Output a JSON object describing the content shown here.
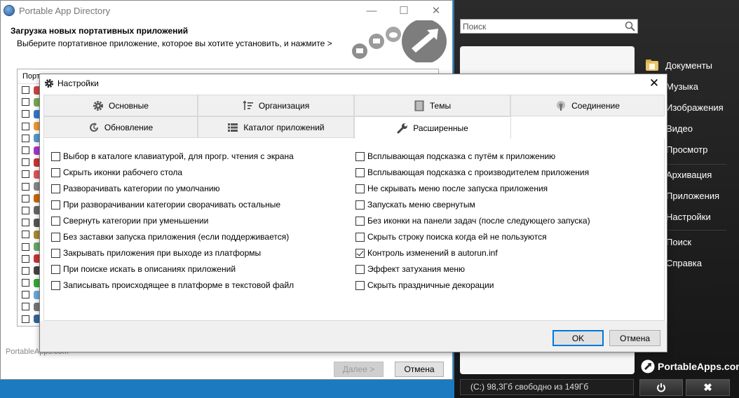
{
  "directory_window": {
    "title": "Portable App Directory",
    "header_title": "Загрузка новых портативных приложений",
    "header_subtitle": "Выберите портативное приложение, которое вы хотите установить, и нажмите >",
    "list_header": "Порт",
    "rows_count_visible": 22,
    "footer_text": "PortableApps.com",
    "next_button": "Далее >",
    "cancel_button": "Отмена"
  },
  "portableapps_menu": {
    "search_placeholder": "Поиск",
    "items": [
      {
        "label": "Документы",
        "icon": "folder-icon"
      },
      {
        "label": "Музыка"
      },
      {
        "label": "Изображения"
      },
      {
        "label": "Видео"
      },
      {
        "label": "Просмотр"
      },
      {
        "label": "Архивация"
      },
      {
        "label": "Приложения"
      },
      {
        "label": "Настройки"
      },
      {
        "label": "Поиск"
      },
      {
        "label": "Справка"
      }
    ],
    "brand": "PortableApps.com",
    "status": "(C:) 98,3Гб свободно из 149Гб",
    "power_icon": "power-icon",
    "close_icon": "close-icon"
  },
  "settings_dialog": {
    "title": "Настройки",
    "tabs_row1": [
      {
        "label": "Основные",
        "icon": "gear-icon"
      },
      {
        "label": "Организация",
        "icon": "sort-icon"
      },
      {
        "label": "Темы",
        "icon": "theme-icon"
      },
      {
        "label": "Соединение",
        "icon": "connection-icon"
      }
    ],
    "tabs_row2": [
      {
        "label": "Обновление",
        "icon": "refresh-icon"
      },
      {
        "label": "Каталог приложений",
        "icon": "catalog-icon"
      },
      {
        "label": "Расширенные",
        "icon": "wrench-icon",
        "active": true
      }
    ],
    "options_left": [
      {
        "label": "Выбор в каталоге клавиатурой, для прогр. чтения с экрана",
        "checked": false
      },
      {
        "label": "Скрыть иконки рабочего стола",
        "checked": false
      },
      {
        "label": "Разворачивать категории по умолчанию",
        "checked": false
      },
      {
        "label": "При разворачивании категории сворачивать остальные",
        "checked": false
      },
      {
        "label": "Свернуть категории при уменьшении",
        "checked": false
      },
      {
        "label": "Без заставки запуска приложения (если поддерживается)",
        "checked": false
      },
      {
        "label": "Закрывать приложения при выходе из платформы",
        "checked": false
      },
      {
        "label": "При поиске искать в описаниях приложений",
        "checked": false
      },
      {
        "label": "Записывать происходящее в платформе в текстовой файл",
        "checked": false
      }
    ],
    "options_right": [
      {
        "label": "Всплывающая подсказка с путём к приложению",
        "checked": false
      },
      {
        "label": "Всплывающая подсказка с производителем приложения",
        "checked": false
      },
      {
        "label": "Не скрывать меню после запуска приложения",
        "checked": false
      },
      {
        "label": "Запускать меню свернутым",
        "checked": false
      },
      {
        "label": "Без иконки на панели задач (после следующего запуска)",
        "checked": false
      },
      {
        "label": "Скрыть строку поиска когда ей не пользуются",
        "checked": false
      },
      {
        "label": "Контроль изменений в autorun.inf",
        "checked": true
      },
      {
        "label": "Эффект затухания меню",
        "checked": false
      },
      {
        "label": "Скрыть праздничные декорации",
        "checked": false
      }
    ],
    "ok_button": "OK",
    "cancel_button": "Отмена"
  }
}
